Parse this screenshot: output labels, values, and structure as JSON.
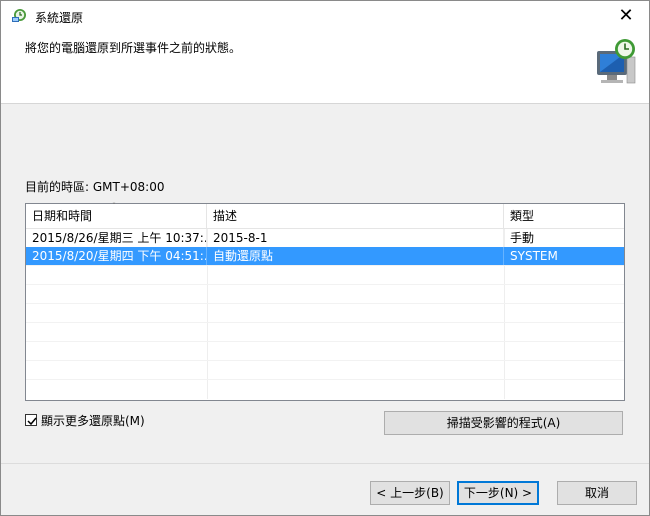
{
  "window": {
    "title": "系統還原",
    "close_glyph": "✕"
  },
  "header": {
    "text": "將您的電腦還原到所選事件之前的狀態。"
  },
  "timezone_label": "目前的時區: GMT+08:00",
  "list": {
    "columns": [
      "日期和時間",
      "描述",
      "類型"
    ],
    "sort_indicator": "ˇ",
    "rows": [
      {
        "date": "2015/8/26/星期三 上午 10:37:...",
        "desc": "2015-8-1",
        "type": "手動",
        "selected": false
      },
      {
        "date": "2015/8/20/星期四 下午 04:51:...",
        "desc": "自動還原點",
        "type": "SYSTEM",
        "selected": true
      }
    ]
  },
  "show_more": {
    "label": "顯示更多還原點(M)",
    "checked": true
  },
  "buttons": {
    "scan": "掃描受影響的程式(A)",
    "back": "< 上一步(B)",
    "next": "下一步(N) >",
    "cancel": "取消"
  },
  "colors": {
    "selection": "#3399ff",
    "default_button_border": "#0078d7"
  }
}
